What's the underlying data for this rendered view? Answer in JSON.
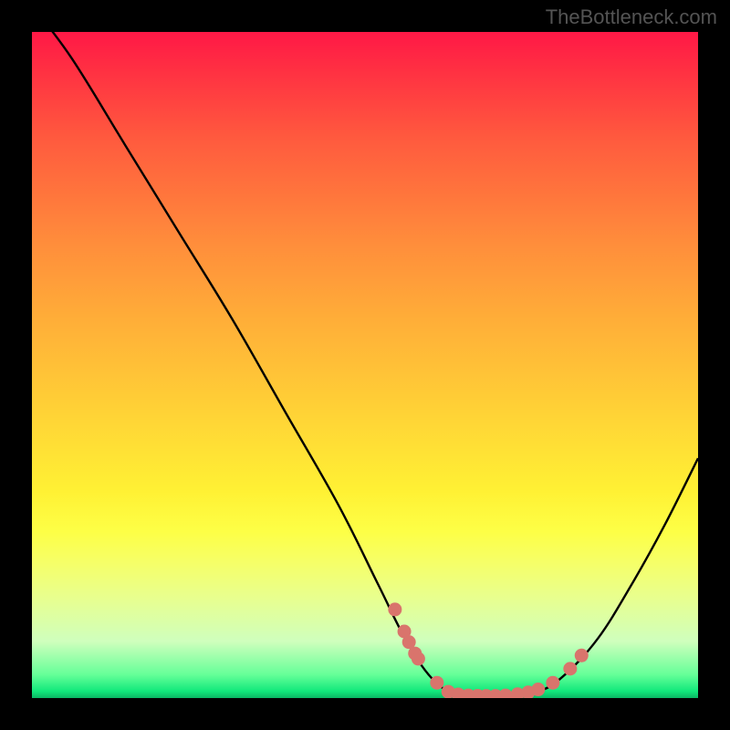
{
  "watermark": "TheBottleneck.com",
  "chart_data": {
    "type": "line",
    "title": "",
    "xlabel": "",
    "ylabel": "",
    "xlim": [
      0,
      100
    ],
    "ylim": [
      0,
      100
    ],
    "curve": [
      {
        "x": 0,
        "y": 104
      },
      {
        "x": 6,
        "y": 96
      },
      {
        "x": 14,
        "y": 83
      },
      {
        "x": 22,
        "y": 70
      },
      {
        "x": 30,
        "y": 57
      },
      {
        "x": 38,
        "y": 43
      },
      {
        "x": 46,
        "y": 29
      },
      {
        "x": 52,
        "y": 17
      },
      {
        "x": 56,
        "y": 9
      },
      {
        "x": 60,
        "y": 3
      },
      {
        "x": 64,
        "y": 0.5
      },
      {
        "x": 70,
        "y": 0.3
      },
      {
        "x": 76,
        "y": 1
      },
      {
        "x": 80,
        "y": 3.5
      },
      {
        "x": 85,
        "y": 9
      },
      {
        "x": 90,
        "y": 17
      },
      {
        "x": 95,
        "y": 26
      },
      {
        "x": 100,
        "y": 36
      }
    ],
    "highlight_points": [
      {
        "x": 54.5,
        "y": 13.3
      },
      {
        "x": 55.9,
        "y": 10.0
      },
      {
        "x": 56.6,
        "y": 8.4
      },
      {
        "x": 57.5,
        "y": 6.7
      },
      {
        "x": 58.0,
        "y": 5.9
      },
      {
        "x": 60.8,
        "y": 2.3
      },
      {
        "x": 62.5,
        "y": 0.95
      },
      {
        "x": 64.0,
        "y": 0.55
      },
      {
        "x": 65.5,
        "y": 0.4
      },
      {
        "x": 66.9,
        "y": 0.35
      },
      {
        "x": 68.2,
        "y": 0.32
      },
      {
        "x": 69.6,
        "y": 0.33
      },
      {
        "x": 71.1,
        "y": 0.4
      },
      {
        "x": 72.9,
        "y": 0.58
      },
      {
        "x": 74.5,
        "y": 0.85
      },
      {
        "x": 76.0,
        "y": 1.3
      },
      {
        "x": 78.2,
        "y": 2.3
      },
      {
        "x": 80.8,
        "y": 4.4
      },
      {
        "x": 82.5,
        "y": 6.4
      }
    ],
    "marker_color": "#d9746c",
    "curve_color": "#000000"
  }
}
